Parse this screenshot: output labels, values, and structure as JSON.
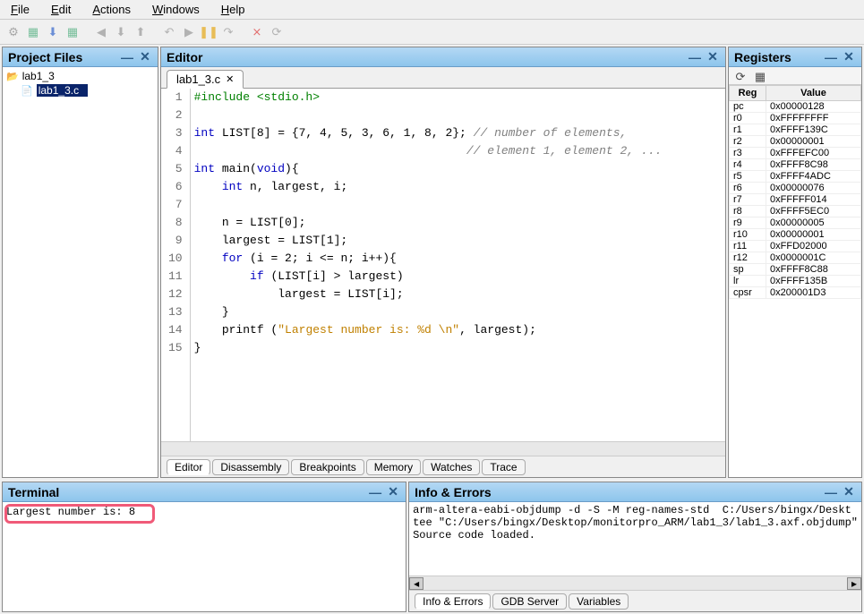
{
  "menus": {
    "file": "File",
    "edit": "Edit",
    "actions": "Actions",
    "windows": "Windows",
    "help": "Help"
  },
  "toolbar_icons": [
    "gear",
    "binary",
    "download",
    "binary2",
    "sep",
    "step-left",
    "step-down",
    "step-up",
    "sep",
    "undo",
    "play",
    "pause",
    "step-over",
    "sep",
    "branch",
    "refresh"
  ],
  "project": {
    "title": "Project Files",
    "root": "lab1_3",
    "file_selected": "lab1_3.c"
  },
  "editor": {
    "title": "Editor",
    "tab": "lab1_3.c",
    "lines": [
      {
        "n": 1,
        "html": "<span class='inc'>#include &lt;stdio.h&gt;</span>"
      },
      {
        "n": 2,
        "html": ""
      },
      {
        "n": 3,
        "html": "<span class='kw'>int</span> LIST[8] = {7, 4, 5, 3, 6, 1, 8, 2}; <span class='cm'>// number of elements,</span>"
      },
      {
        "n": 4,
        "html": "                                       <span class='cm'>// element 1, element 2, ...</span>"
      },
      {
        "n": 5,
        "html": "<span class='kw'>int</span> main(<span class='kw'>void</span>){"
      },
      {
        "n": 6,
        "html": "    <span class='kw'>int</span> n, largest, i;"
      },
      {
        "n": 7,
        "html": ""
      },
      {
        "n": 8,
        "html": "    n = LIST[0];"
      },
      {
        "n": 9,
        "html": "    largest = LIST[1];"
      },
      {
        "n": 10,
        "html": "    <span class='kw'>for</span> (i = 2; i &lt;= n; i++){"
      },
      {
        "n": 11,
        "html": "        <span class='kw'>if</span> (LIST[i] &gt; largest)"
      },
      {
        "n": 12,
        "html": "            largest = LIST[i];"
      },
      {
        "n": 13,
        "html": "    }"
      },
      {
        "n": 14,
        "html": "    printf (<span class='str'>\"Largest number is: %d \\n\"</span>, largest);"
      },
      {
        "n": 15,
        "html": "}"
      }
    ],
    "bottom_tabs": [
      "Editor",
      "Disassembly",
      "Breakpoints",
      "Memory",
      "Watches",
      "Trace"
    ]
  },
  "registers": {
    "title": "Registers",
    "header": {
      "reg": "Reg",
      "value": "Value"
    },
    "rows": [
      {
        "r": "pc",
        "v": "0x00000128"
      },
      {
        "r": "r0",
        "v": "0xFFFFFFFF"
      },
      {
        "r": "r1",
        "v": "0xFFFF139C"
      },
      {
        "r": "r2",
        "v": "0x00000001"
      },
      {
        "r": "r3",
        "v": "0xFFFEFC00"
      },
      {
        "r": "r4",
        "v": "0xFFFF8C98"
      },
      {
        "r": "r5",
        "v": "0xFFFF4ADC"
      },
      {
        "r": "r6",
        "v": "0x00000076"
      },
      {
        "r": "r7",
        "v": "0xFFFFF014"
      },
      {
        "r": "r8",
        "v": "0xFFFF5EC0"
      },
      {
        "r": "r9",
        "v": "0x00000005"
      },
      {
        "r": "r10",
        "v": "0x00000001"
      },
      {
        "r": "r11",
        "v": "0xFFD02000"
      },
      {
        "r": "r12",
        "v": "0x0000001C"
      },
      {
        "r": "sp",
        "v": "0xFFFF8C88"
      },
      {
        "r": "lr",
        "v": "0xFFFF135B"
      },
      {
        "r": "cpsr",
        "v": "0x200001D3"
      }
    ]
  },
  "terminal": {
    "title": "Terminal",
    "output": "Largest number is: 8"
  },
  "info": {
    "title": "Info & Errors",
    "lines": [
      "arm-altera-eabi-objdump -d -S -M reg-names-std  C:/Users/bingx/Deskt",
      "tee \"C:/Users/bingx/Desktop/monitorpro_ARM/lab1_3/lab1_3.axf.objdump\"",
      "Source code loaded."
    ],
    "tabs": [
      "Info & Errors",
      "GDB Server",
      "Variables"
    ]
  },
  "glyphs": {
    "minimize": "—",
    "close": "✕",
    "tab_close": "✕"
  }
}
